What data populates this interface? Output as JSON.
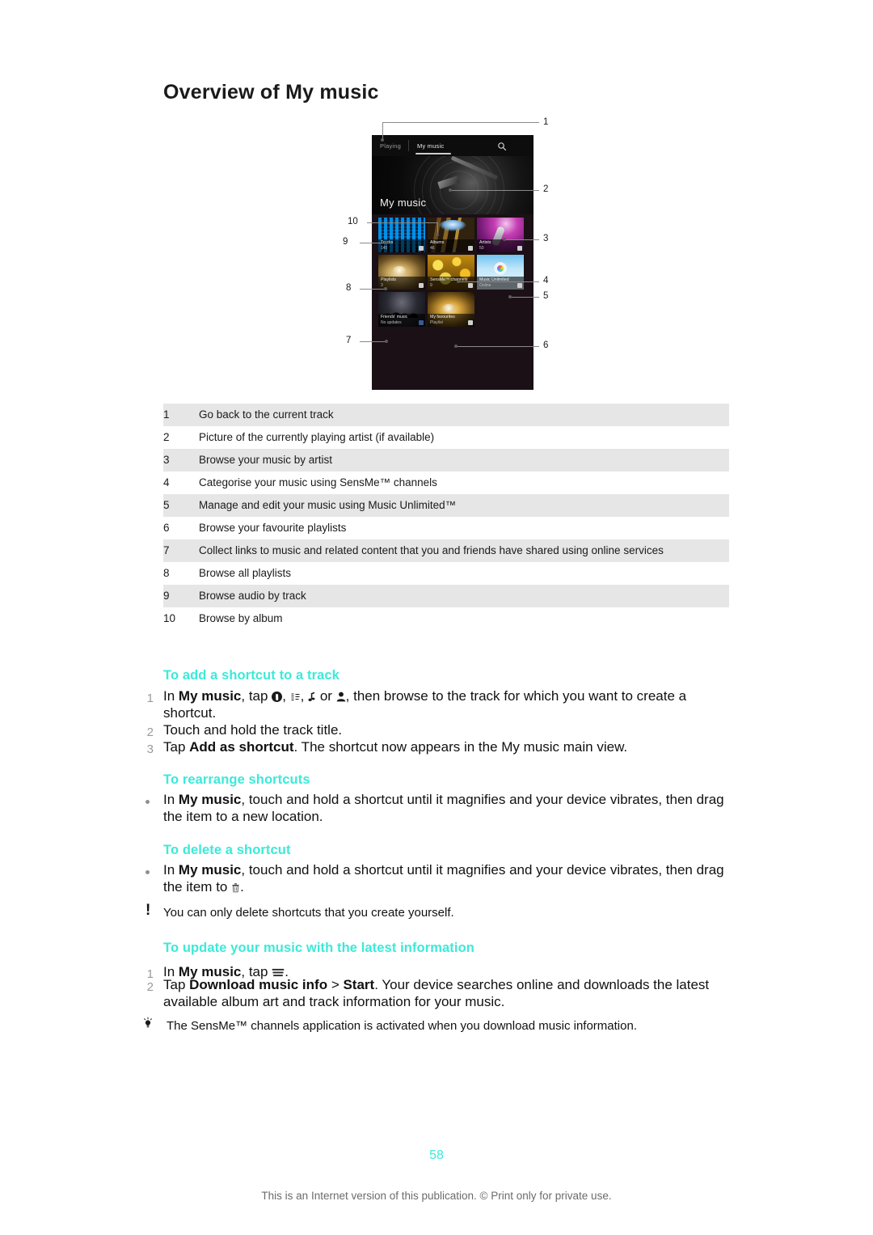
{
  "document": {
    "title": "Overview of My music",
    "page_number": "58",
    "footer_note": "This is an Internet version of this publication. © Print only for private use."
  },
  "figure": {
    "alt_name": "my-music-screen-callout-diagram",
    "phone_ui": {
      "tabs": [
        "Playing",
        "My music"
      ],
      "selected_tab": "My music",
      "search_icon": "search-icon",
      "overflow_icon": "overflow-menu-icon",
      "hero_label": "My music",
      "tiles": [
        {
          "title": "Tracks",
          "sub": "145",
          "badge": "music-note-badge"
        },
        {
          "title": "Albums",
          "sub": "46",
          "badge": "album-badge"
        },
        {
          "title": "Artists",
          "sub": "50",
          "badge": "person-badge"
        },
        {
          "title": "Playlists",
          "sub": "3",
          "badge": "playlist-badge"
        },
        {
          "title": "SensMe™ channels",
          "sub": "9",
          "badge": "sensme-badge"
        },
        {
          "title": "Music Unlimited",
          "sub": "Online",
          "badge": "music-unlimited-badge"
        },
        {
          "title": "Friends' music",
          "sub": "No updates",
          "badge": "facebook-badge"
        },
        {
          "title": "My favourites",
          "sub": "Playlist",
          "badge": "bookmark-badge"
        }
      ]
    },
    "callouts": [
      "1",
      "2",
      "3",
      "4",
      "5",
      "6",
      "7",
      "8",
      "9",
      "10"
    ]
  },
  "legend": {
    "rows": [
      {
        "num": "1",
        "text": "Go back to the current track"
      },
      {
        "num": "2",
        "text": "Picture of the currently playing artist (if available)"
      },
      {
        "num": "3",
        "text": "Browse your music by artist"
      },
      {
        "num": "4",
        "text": "Categorise your music using SensMe™ channels"
      },
      {
        "num": "5",
        "text": "Manage and edit your music using Music Unlimited™"
      },
      {
        "num": "6",
        "text": "Browse your favourite playlists"
      },
      {
        "num": "7",
        "text": "Collect links to music and related content that you and friends have shared using online services"
      },
      {
        "num": "8",
        "text": "Browse all playlists"
      },
      {
        "num": "9",
        "text": "Browse audio by track"
      },
      {
        "num": "10",
        "text": "Browse by album"
      }
    ]
  },
  "sections": {
    "add_shortcut": {
      "heading": "To add a shortcut to a track",
      "steps": [
        {
          "num": "1",
          "prefix": "In ",
          "bold1": "My music",
          "mid": ", tap ",
          "icons": [
            "disc-icon",
            "list-icon",
            "music-note-icon",
            "person-icon"
          ],
          "suffix": ", then browse to the track for which you want to create a shortcut."
        },
        {
          "num": "2",
          "text": "Touch and hold the track title."
        },
        {
          "num": "3",
          "prefix": "Tap ",
          "bold1": "Add as shortcut",
          "suffix": ". The shortcut now appears in the My music main view."
        }
      ]
    },
    "rearrange": {
      "heading": "To rearrange shortcuts",
      "bullet": {
        "prefix": "In ",
        "bold1": "My music",
        "suffix": ", touch and hold a shortcut until it magnifies and your device vibrates, then drag the item to a new location."
      }
    },
    "delete": {
      "heading": "To delete a shortcut",
      "bullet": {
        "prefix": "In ",
        "bold1": "My music",
        "suffix": ", touch and hold a shortcut until it magnifies and your device vibrates, then drag the item to ",
        "trailing": "."
      },
      "note_icon": "exclamation-icon",
      "note": "You can only delete shortcuts that you create yourself."
    },
    "update": {
      "heading": "To update your music with the latest information",
      "steps": [
        {
          "num": "1",
          "prefix": "In ",
          "bold1": "My music",
          "mid": ", tap ",
          "suffix": "."
        },
        {
          "num": "2",
          "prefix": "Tap ",
          "bold1": "Download music info",
          "mid": " > ",
          "bold2": "Start",
          "suffix": ". Your device searches online and downloads the latest available album art and track information for your music."
        }
      ],
      "tip_icon": "lightbulb-icon",
      "tip": "The SensMe™ channels application is activated when you download music information."
    }
  },
  "colors": {
    "accent": "#3bead8",
    "table_stripe": "#e6e6e6",
    "text": "#111111",
    "muted": "#6b6b6b"
  }
}
